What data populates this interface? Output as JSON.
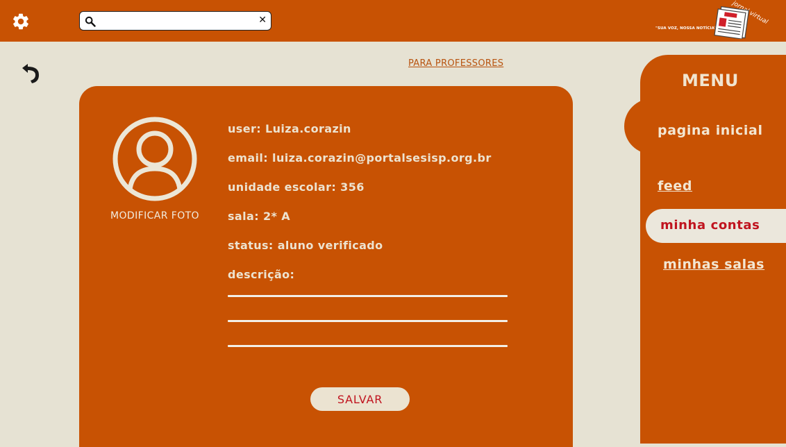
{
  "header": {
    "search": {
      "value": "",
      "placeholder": ""
    },
    "logo": {
      "slogan": "\"SUA VOZ, NOSSA NOTÍCIA\"",
      "brand": "jornal virtual"
    }
  },
  "links": {
    "professores": "PARA PROFESSORES"
  },
  "profile": {
    "modify_photo": "MODIFICAR FOTO",
    "user": "user: Luiza.corazin",
    "email": "email: luiza.corazin@portalsesisp.org.br",
    "school": "unidade escolar: 356",
    "room": "sala: 2* A",
    "status": "status: aluno verificado",
    "description_label": "descrição:",
    "description_lines": [
      "",
      "",
      ""
    ],
    "save": "SALVAR"
  },
  "menu": {
    "title": "MENU",
    "items": [
      {
        "label": "pagina inicial"
      },
      {
        "label": "feed"
      },
      {
        "label": "minha contas",
        "active": true
      },
      {
        "label": "minhas salas"
      }
    ]
  },
  "colors": {
    "primary": "#c85203",
    "background": "#e6e2d3",
    "accent_text": "#c0141f",
    "light_text": "#ede3d0"
  },
  "icons": [
    "gear-icon",
    "search-icon",
    "close-icon",
    "undo-arrow-icon",
    "user-avatar-icon",
    "newspaper-icon"
  ]
}
